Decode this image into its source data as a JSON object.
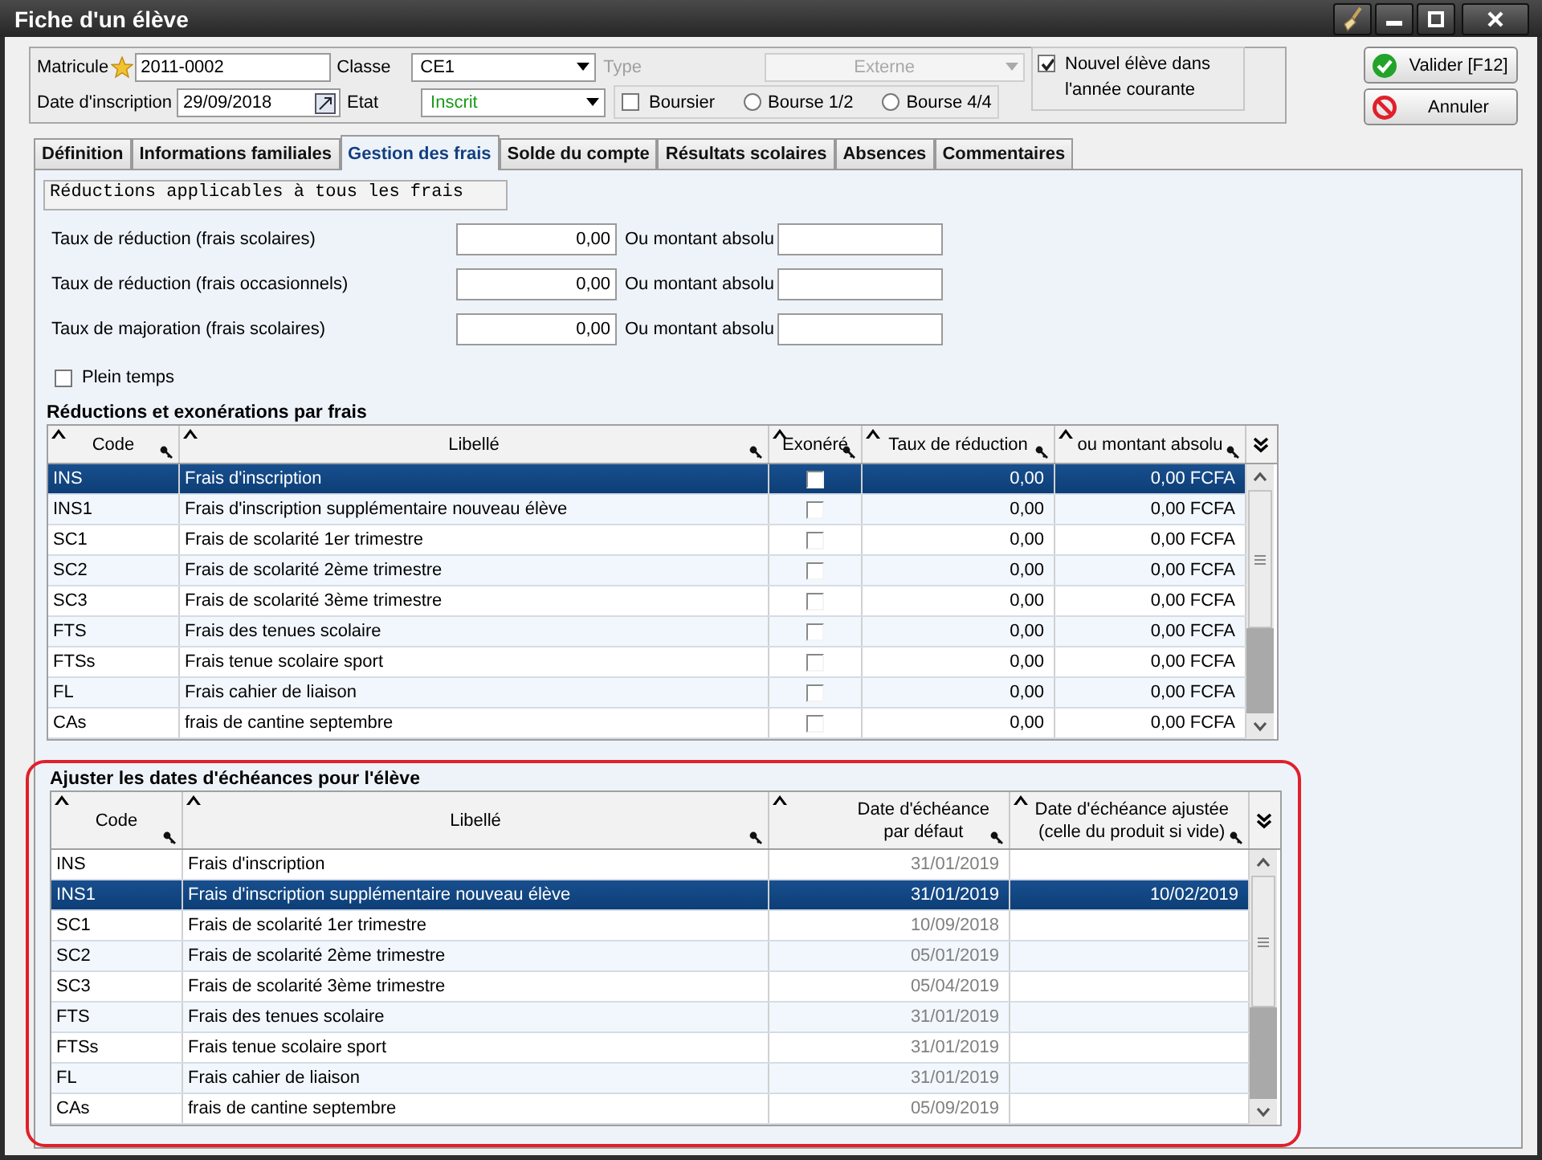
{
  "window": {
    "title": "Fiche d'un élève"
  },
  "header": {
    "matricule": {
      "label": "Matricule",
      "value": "2011-0002"
    },
    "classe": {
      "label": "Classe",
      "value": "CE1"
    },
    "type": {
      "label": "Type",
      "value": "Externe",
      "disabled": true
    },
    "date_inscription": {
      "label": "Date d'inscription",
      "value": "29/09/2018"
    },
    "etat": {
      "label": "Etat",
      "value": "Inscrit"
    },
    "boursier": {
      "label": "Boursier",
      "checked": false
    },
    "bourse_options": [
      {
        "label": "Bourse 1/2",
        "selected": false
      },
      {
        "label": "Bourse 4/4",
        "selected": false
      }
    ],
    "nouvel_eleve": {
      "label": "Nouvel élève dans l'année courante",
      "checked": true
    }
  },
  "buttons": [
    {
      "label": "Valider [F12]",
      "kind": "ok"
    },
    {
      "label": "Annuler",
      "kind": "cancel"
    }
  ],
  "tabs": [
    {
      "label": "Définition",
      "selected": false
    },
    {
      "label": "Informations familiales",
      "selected": false
    },
    {
      "label": "Gestion des frais",
      "selected": true
    },
    {
      "label": "Solde du compte",
      "selected": false
    },
    {
      "label": "Résultats scolaires",
      "selected": false
    },
    {
      "label": "Absences",
      "selected": false
    },
    {
      "label": "Commentaires",
      "selected": false
    }
  ],
  "reductions": {
    "title": "Réductions applicables à tous les frais",
    "rows": [
      {
        "label": "Taux de réduction (frais scolaires)",
        "value": "0,00",
        "alt_label": "Ou montant absolu"
      },
      {
        "label": "Taux de réduction (frais occasionnels)",
        "value": "0,00",
        "alt_label": "Ou montant absolu"
      },
      {
        "label": "Taux de majoration (frais scolaires)",
        "value": "0,00",
        "alt_label": "Ou montant absolu"
      }
    ],
    "plein_temps": {
      "label": "Plein temps",
      "checked": false
    }
  },
  "fees_table": {
    "title": "Réductions et exonérations par frais",
    "columns": [
      "Code",
      "Libellé",
      "Exonéré",
      "Taux de réduction",
      "ou montant absolu"
    ],
    "rows": [
      {
        "code": "INS",
        "libelle": "Frais d'inscription",
        "exonere": false,
        "taux": "0,00",
        "montant": "0,00 FCFA",
        "selected": true
      },
      {
        "code": "INS1",
        "libelle": "Frais d'inscription supplémentaire nouveau élève",
        "exonere": false,
        "taux": "0,00",
        "montant": "0,00 FCFA",
        "selected": false
      },
      {
        "code": "SC1",
        "libelle": "Frais de scolarité 1er trimestre",
        "exonere": false,
        "taux": "0,00",
        "montant": "0,00 FCFA",
        "selected": false
      },
      {
        "code": "SC2",
        "libelle": "Frais de scolarité 2ème  trimestre",
        "exonere": false,
        "taux": "0,00",
        "montant": "0,00 FCFA",
        "selected": false
      },
      {
        "code": "SC3",
        "libelle": "Frais de scolarité 3ème  trimestre",
        "exonere": false,
        "taux": "0,00",
        "montant": "0,00 FCFA",
        "selected": false
      },
      {
        "code": "FTS",
        "libelle": "Frais des tenues scolaire",
        "exonere": false,
        "taux": "0,00",
        "montant": "0,00 FCFA",
        "selected": false
      },
      {
        "code": "FTSs",
        "libelle": "Frais tenue scolaire sport",
        "exonere": false,
        "taux": "0,00",
        "montant": "0,00 FCFA",
        "selected": false
      },
      {
        "code": "FL",
        "libelle": "Frais cahier de liaison",
        "exonere": false,
        "taux": "0,00",
        "montant": "0,00 FCFA",
        "selected": false
      },
      {
        "code": "CAs",
        "libelle": "frais de cantine septembre",
        "exonere": false,
        "taux": "0,00",
        "montant": "0,00 FCFA",
        "selected": false
      }
    ]
  },
  "dates_table": {
    "title": "Ajuster les dates d'échéances pour l'élève",
    "columns": [
      "Code",
      "Libellé",
      "Date d'échéance\npar défaut",
      "Date d'échéance ajustée\n(celle du produit si vide)"
    ],
    "rows": [
      {
        "code": "INS",
        "libelle": "Frais d'inscription",
        "date_defaut": "31/01/2019",
        "selected": false
      },
      {
        "code": "INS1",
        "libelle": "Frais d'inscription supplémentaire nouveau élève",
        "date_defaut": "31/01/2019",
        "date_ajustee": "10/02/2019",
        "selected": true
      },
      {
        "code": "SC1",
        "libelle": "Frais de scolarité 1er trimestre",
        "date_defaut": "10/09/2018",
        "selected": false
      },
      {
        "code": "SC2",
        "libelle": "Frais de scolarité 2ème  trimestre",
        "date_defaut": "05/01/2019",
        "selected": false
      },
      {
        "code": "SC3",
        "libelle": "Frais de scolarité 3ème  trimestre",
        "date_defaut": "05/04/2019",
        "selected": false
      },
      {
        "code": "FTS",
        "libelle": "Frais des tenues scolaire",
        "date_defaut": "31/01/2019",
        "selected": false
      },
      {
        "code": "FTSs",
        "libelle": "Frais tenue scolaire sport",
        "date_defaut": "31/01/2019",
        "selected": false
      },
      {
        "code": "FL",
        "libelle": "Frais cahier de liaison",
        "date_defaut": "31/01/2019",
        "selected": false
      },
      {
        "code": "CAs",
        "libelle": "frais de cantine septembre",
        "date_defaut": "05/09/2019",
        "selected": false
      }
    ]
  }
}
